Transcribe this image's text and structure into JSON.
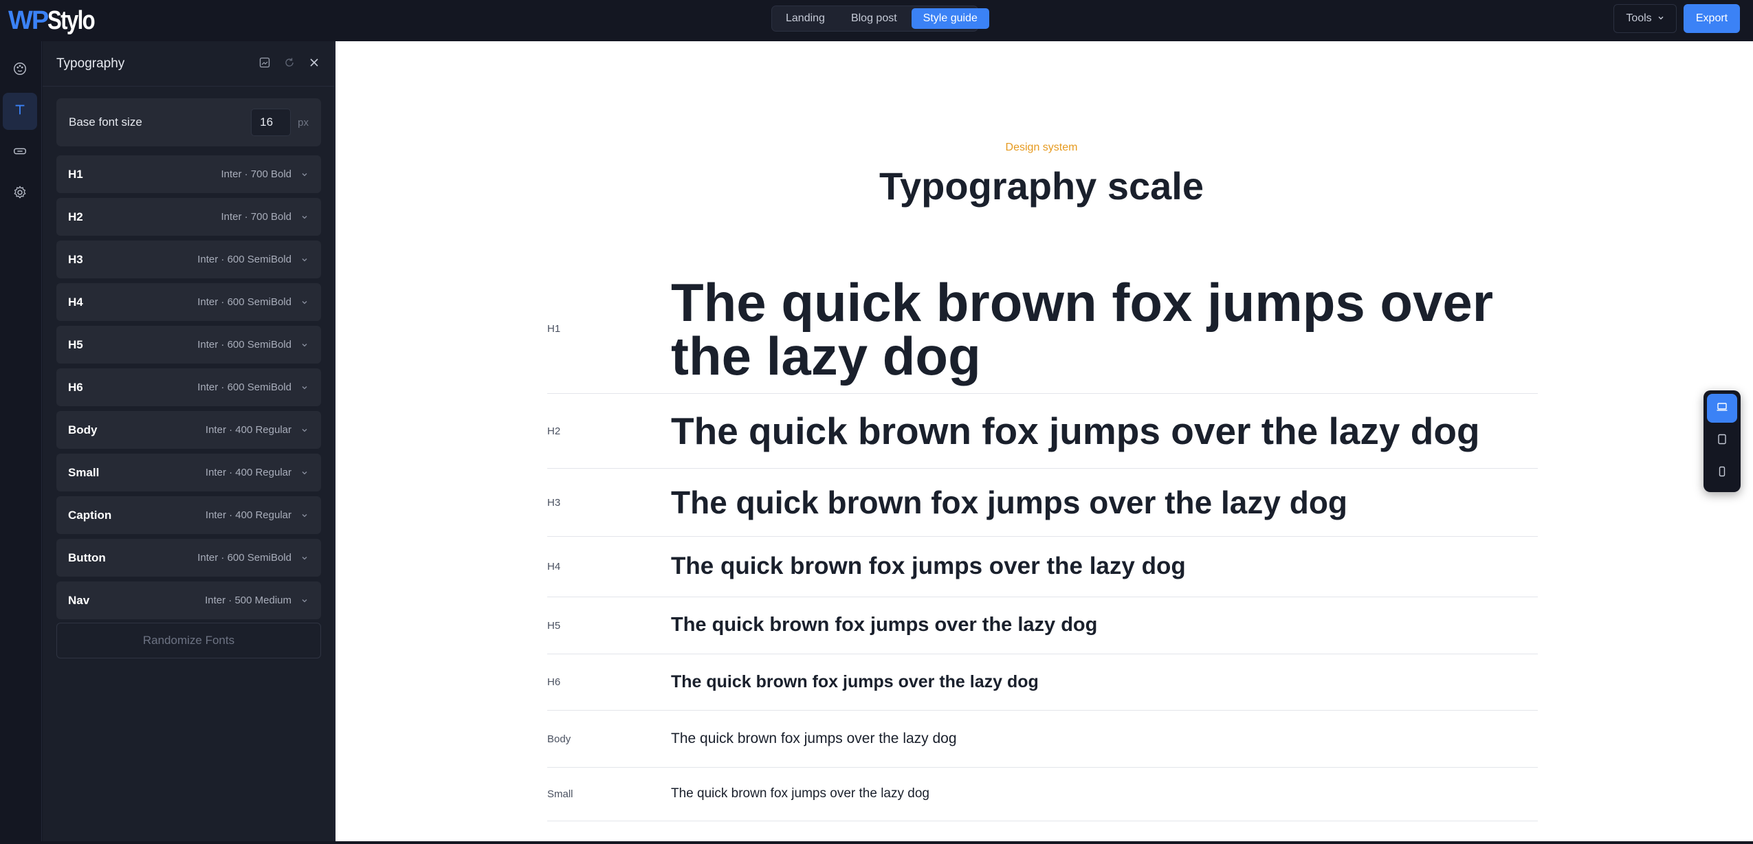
{
  "logo": {
    "wp": "WP",
    "stylo": "Stylo"
  },
  "tabs": [
    {
      "label": "Landing",
      "active": false
    },
    {
      "label": "Blog post",
      "active": false
    },
    {
      "label": "Style guide",
      "active": true
    }
  ],
  "toolbar": {
    "tools_label": "Tools",
    "export_label": "Export"
  },
  "rail": {
    "items": [
      "palette-icon",
      "type-icon",
      "button-icon",
      "gear-icon"
    ],
    "active": "type-icon"
  },
  "panel": {
    "title": "Typography",
    "base_font": {
      "label": "Base font size",
      "value": "16",
      "unit": "px"
    },
    "rows": [
      {
        "name": "H1",
        "font": "Inter · 700 Bold"
      },
      {
        "name": "H2",
        "font": "Inter · 700 Bold"
      },
      {
        "name": "H3",
        "font": "Inter · 600 SemiBold"
      },
      {
        "name": "H4",
        "font": "Inter · 600 SemiBold"
      },
      {
        "name": "H5",
        "font": "Inter · 600 SemiBold"
      },
      {
        "name": "H6",
        "font": "Inter · 600 SemiBold"
      },
      {
        "name": "Body",
        "font": "Inter · 400 Regular"
      },
      {
        "name": "Small",
        "font": "Inter · 400 Regular"
      },
      {
        "name": "Caption",
        "font": "Inter · 400 Regular"
      },
      {
        "name": "Button",
        "font": "Inter · 600 SemiBold"
      },
      {
        "name": "Nav",
        "font": "Inter · 500 Medium"
      }
    ],
    "randomize_label": "Randomize Fonts"
  },
  "canvas": {
    "eyebrow": "Design system",
    "title": "Typography scale",
    "sample": "The quick brown fox jumps over the lazy dog",
    "scale": [
      {
        "label": "H1"
      },
      {
        "label": "H2"
      },
      {
        "label": "H3"
      },
      {
        "label": "H4"
      },
      {
        "label": "H5"
      },
      {
        "label": "H6"
      },
      {
        "label": "Body"
      },
      {
        "label": "Small"
      }
    ]
  },
  "devices": [
    "desktop-icon",
    "tablet-icon",
    "mobile-icon"
  ],
  "colors": {
    "accent": "#3b82f6",
    "eyebrow": "#e69a1f",
    "chrome": "#141722",
    "panel": "#1b1f2a"
  }
}
